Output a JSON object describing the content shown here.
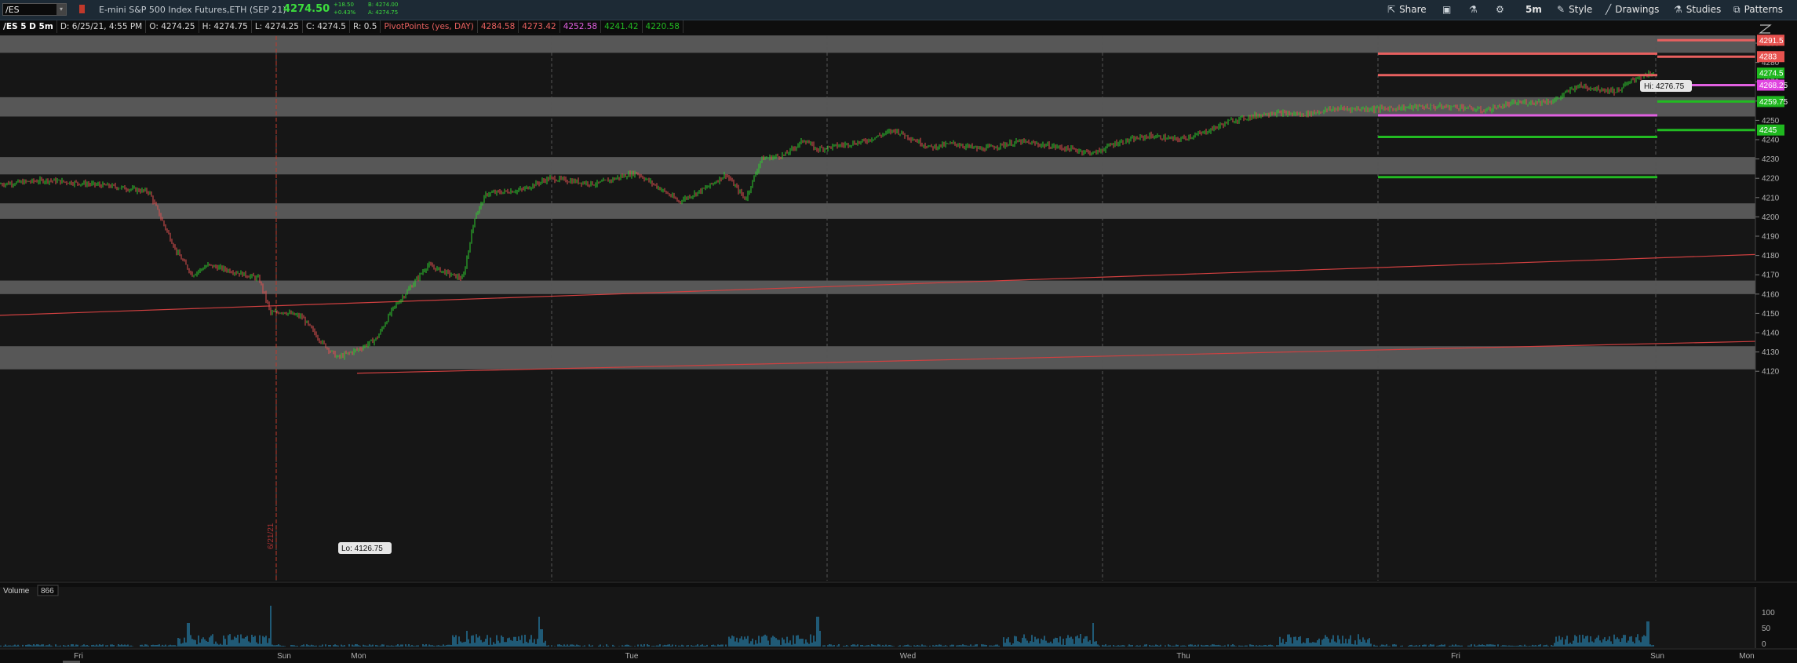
{
  "toolbar": {
    "symbol": "/ES",
    "description": "E-mini S&P 500 Index Futures,ETH (SEP 21)",
    "last_price": "4274.50",
    "change": "+18.50",
    "change_pct": "+0.43%",
    "bid": "B: 4274.00",
    "ask": "A: 4274.75",
    "buttons": {
      "share": "Share",
      "interval": "5m",
      "style": "Style",
      "drawings": "Drawings",
      "studies": "Studies",
      "patterns": "Patterns"
    }
  },
  "ohlc_bar": {
    "title": "/ES 5 D 5m",
    "date": "D: 6/25/21, 4:55 PM",
    "open": "O: 4274.25",
    "high": "H: 4274.75",
    "low": "L: 4274.25",
    "close": "C: 4274.5",
    "range": "R: 0.5",
    "study": "PivotPoints (yes, DAY)",
    "pivots": [
      "4284.58",
      "4273.42",
      "4252.58",
      "4241.42",
      "4220.58"
    ]
  },
  "price_axis": {
    "ticks": [
      "4290",
      "4280",
      "4270",
      "4260",
      "4250",
      "4240",
      "4230",
      "4220",
      "4210",
      "4200",
      "4190",
      "4180",
      "4170",
      "4160",
      "4150",
      "4140",
      "4130",
      "4120"
    ],
    "labels": [
      {
        "text": "4291.5",
        "color": "#e8524f"
      },
      {
        "text": "4283",
        "color": "#e8524f"
      },
      {
        "text": "4274.5",
        "color": "#1fb81f"
      },
      {
        "text": "4268.25",
        "color": "#e045e0"
      },
      {
        "text": "4259.75",
        "color": "#1fb81f"
      },
      {
        "text": "4245",
        "color": "#1fb81f"
      }
    ]
  },
  "annotations": {
    "hi": "Hi: 4276.75",
    "lo": "Lo: 4126.75",
    "session_date": "6/21/21"
  },
  "time_axis": {
    "labels": [
      "Fri",
      "Sun",
      "Mon",
      "Tue",
      "Wed",
      "Thu",
      "Fri",
      "Sun",
      "Mon"
    ]
  },
  "volume_panel": {
    "label": "Volume",
    "value": "866",
    "ticks": [
      "100",
      "50",
      "0"
    ]
  },
  "colors": {
    "candle_up": "#2ecc2e",
    "candle_down": "#e05050",
    "zone": "#6a6a6a",
    "pivot_red": "#e8605f",
    "pivot_magenta": "#e060e0",
    "pivot_green": "#22bb22",
    "volume": "#2a9fd6"
  }
}
